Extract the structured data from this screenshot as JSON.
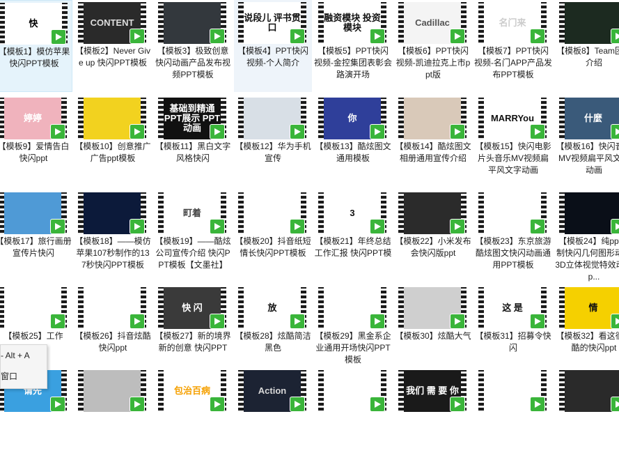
{
  "items": [
    {
      "label": "【模板1】模仿苹果快闪PPT模板",
      "thumb_text": "快",
      "bg": "#ffffff",
      "fg": "#000000",
      "state": "selected"
    },
    {
      "label": "【模板2】Never Give up 快闪PPT模板",
      "thumb_text": "CONTENT",
      "bg": "#2a2a2a",
      "fg": "#dddddd",
      "state": ""
    },
    {
      "label": "【模板3】极致创意快闪动画产品发布视频PPT模板",
      "thumb_text": "",
      "bg": "#33383d",
      "fg": "#ffffff",
      "state": ""
    },
    {
      "label": "【模板4】PPT快闪视频-个人简介",
      "thumb_text": "说段儿 评书贯口",
      "bg": "#ffffff",
      "fg": "#111111",
      "state": "hover"
    },
    {
      "label": "【模板5】PPT快闪视频-金控集团表彰会路演开场",
      "thumb_text": "融资模块 投资模块",
      "bg": "#ffffff",
      "fg": "#111111",
      "state": ""
    },
    {
      "label": "【模板6】PPT快闪视频-凯迪拉克上市ppt版",
      "thumb_text": "Cadillac",
      "bg": "#f4f4f4",
      "fg": "#555555",
      "state": ""
    },
    {
      "label": "【模板7】PPT快闪视频-名门APP产品发布PPT模板",
      "thumb_text": "名门来",
      "bg": "#ffffff",
      "fg": "#cccccc",
      "state": ""
    },
    {
      "label": "【模板8】Team团队介绍",
      "thumb_text": "",
      "bg": "#1c2a20",
      "fg": "#ffffff",
      "state": ""
    },
    {
      "label": "【模板9】爱情告白快闪ppt",
      "thumb_text": "婷婷",
      "bg": "#f0b3bd",
      "fg": "#ffffff",
      "state": ""
    },
    {
      "label": "【模板10】创意推广广告ppt模板",
      "thumb_text": "",
      "bg": "#f2d21f",
      "fg": "#000000",
      "state": ""
    },
    {
      "label": "【模板11】黑白文字风格快闪",
      "thumb_text": "基础到精通 PPT展示 PPT动画",
      "bg": "#111111",
      "fg": "#ffffff",
      "state": ""
    },
    {
      "label": "【模板12】华为手机宣传",
      "thumb_text": "",
      "bg": "#d8dfe6",
      "fg": "#333333",
      "state": ""
    },
    {
      "label": "【模板13】酷炫图文通用模板",
      "thumb_text": "你",
      "bg": "#2f3f9a",
      "fg": "#ffffff",
      "state": ""
    },
    {
      "label": "【模板14】酷炫图文相册通用宣传介绍",
      "thumb_text": "",
      "bg": "#d9c9b9",
      "fg": "#333333",
      "state": ""
    },
    {
      "label": "【模板15】快闪电影片头音乐MV视频扁平风文字动画",
      "thumb_text": "MARRYou",
      "bg": "#ffffff",
      "fg": "#111111",
      "state": ""
    },
    {
      "label": "【模板16】快闪音乐MV视频扁平风文字动画",
      "thumb_text": "什麼",
      "bg": "#3a5a7a",
      "fg": "#ffffff",
      "state": ""
    },
    {
      "label": "【模板17】旅行画册宣传片快闪",
      "thumb_text": "",
      "bg": "#4f9ad6",
      "fg": "#ffffff",
      "state": ""
    },
    {
      "label": "【模板18】——模仿苹果107秒制作的137秒快闪PPT模板",
      "thumb_text": "",
      "bg": "#0c1a3a",
      "fg": "#ffffff",
      "state": ""
    },
    {
      "label": "【模板19】——酷炫公司宣传介绍 快闪PPT模板【文墨社】",
      "thumb_text": "町着",
      "bg": "#ffffff",
      "fg": "#444444",
      "state": ""
    },
    {
      "label": "【模板20】抖音纸短情长快闪PPT模板",
      "thumb_text": "",
      "bg": "#ffffff",
      "fg": "#111111",
      "state": ""
    },
    {
      "label": "【模板21】年终总结 工作汇报 快闪PPT模",
      "thumb_text": "3",
      "bg": "#ffffff",
      "fg": "#111111",
      "state": ""
    },
    {
      "label": "【模板22】小米发布会快闪版ppt",
      "thumb_text": "",
      "bg": "#2b2b2b",
      "fg": "#ffffff",
      "state": ""
    },
    {
      "label": "【模板23】东京旅游酷炫图文快闪动画通用PPT模板",
      "thumb_text": "",
      "bg": "#ffffff",
      "fg": "#e58a1f",
      "state": ""
    },
    {
      "label": "【模板24】纯ppt绘制快闪几何图形动感3D立体视觉特效动画p...",
      "thumb_text": "",
      "bg": "#0a0f18",
      "fg": "#ffffff",
      "state": ""
    },
    {
      "label": "【模板25】工作",
      "thumb_text": "",
      "bg": "#ffffff",
      "fg": "#111111",
      "state": ""
    },
    {
      "label": "【模板26】抖音炫酷快闪ppt",
      "thumb_text": "",
      "bg": "#ffffff",
      "fg": "#111111",
      "state": ""
    },
    {
      "label": "【模板27】新的境界新的创意 快闪PPT",
      "thumb_text": "快 闪",
      "bg": "#3a3a3a",
      "fg": "#ffffff",
      "state": ""
    },
    {
      "label": "【模板28】炫酷简洁黑色",
      "thumb_text": "放",
      "bg": "#ffffff",
      "fg": "#111111",
      "state": ""
    },
    {
      "label": "【模板29】黑金系企业通用开场快闪PPT模板",
      "thumb_text": "",
      "bg": "#ffffff",
      "fg": "#111111",
      "state": ""
    },
    {
      "label": "【模板30】炫酷大气",
      "thumb_text": "",
      "bg": "#cfcfcf",
      "fg": "#111111",
      "state": ""
    },
    {
      "label": "【模板31】招募令快闪",
      "thumb_text": "这 是",
      "bg": "#ffffff",
      "fg": "#111111",
      "state": ""
    },
    {
      "label": "【模板32】看这很炫酷的快闪ppt",
      "thumb_text": "情",
      "bg": "#f5d000",
      "fg": "#111111",
      "state": ""
    },
    {
      "label": "",
      "thumb_text": "请先",
      "bg": "#3aa0e0",
      "fg": "#ffffff",
      "state": ""
    },
    {
      "label": "",
      "thumb_text": "",
      "bg": "#bdbdbd",
      "fg": "#ffffff",
      "state": ""
    },
    {
      "label": "",
      "thumb_text": "包治百病",
      "bg": "#ffffff",
      "fg": "#f5a000",
      "state": ""
    },
    {
      "label": "",
      "thumb_text": "Action",
      "bg": "#1c2333",
      "fg": "#d8d8d8",
      "state": ""
    },
    {
      "label": "",
      "thumb_text": "",
      "bg": "#ffffff",
      "fg": "#111111",
      "state": ""
    },
    {
      "label": "",
      "thumb_text": "我们 需 要 你",
      "bg": "#1a1a1a",
      "fg": "#ffffff",
      "state": ""
    },
    {
      "label": "",
      "thumb_text": "",
      "bg": "#ffffff",
      "fg": "#111111",
      "state": ""
    },
    {
      "label": "",
      "thumb_text": "",
      "bg": "#2a2a2a",
      "fg": "#ffffff",
      "state": ""
    }
  ],
  "context_menu": {
    "line1": "- Alt + A",
    "line2": "窗口"
  },
  "colors": {
    "badge": "#3ab53a",
    "selected": "#e5f3fb"
  }
}
